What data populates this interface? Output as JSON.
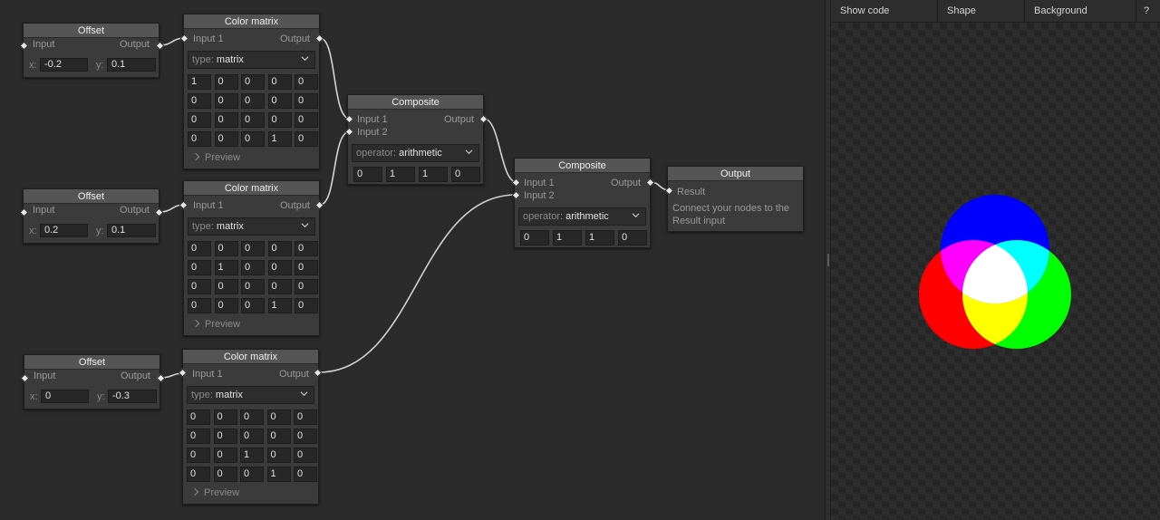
{
  "nodes": {
    "offset1": {
      "title": "Offset",
      "input": "Input",
      "output": "Output",
      "x_label": "x:",
      "x": "-0.2",
      "y_label": "y:",
      "y": "0.1"
    },
    "offset2": {
      "title": "Offset",
      "input": "Input",
      "output": "Output",
      "x_label": "x:",
      "x": "0.2",
      "y_label": "y:",
      "y": "0.1"
    },
    "offset3": {
      "title": "Offset",
      "input": "Input",
      "output": "Output",
      "x_label": "x:",
      "x": "0",
      "y_label": "y:",
      "y": "-0.3"
    },
    "matrix1": {
      "title": "Color matrix",
      "input": "Input 1",
      "output": "Output",
      "type_label": "type:",
      "type": "matrix",
      "rows": [
        [
          "1",
          "0",
          "0",
          "0",
          "0"
        ],
        [
          "0",
          "0",
          "0",
          "0",
          "0"
        ],
        [
          "0",
          "0",
          "0",
          "0",
          "0"
        ],
        [
          "0",
          "0",
          "0",
          "1",
          "0"
        ]
      ],
      "preview": "Preview"
    },
    "matrix2": {
      "title": "Color matrix",
      "input": "Input 1",
      "output": "Output",
      "type_label": "type:",
      "type": "matrix",
      "rows": [
        [
          "0",
          "0",
          "0",
          "0",
          "0"
        ],
        [
          "0",
          "1",
          "0",
          "0",
          "0"
        ],
        [
          "0",
          "0",
          "0",
          "0",
          "0"
        ],
        [
          "0",
          "0",
          "0",
          "1",
          "0"
        ]
      ],
      "preview": "Preview"
    },
    "matrix3": {
      "title": "Color matrix",
      "input": "Input 1",
      "output": "Output",
      "type_label": "type:",
      "type": "matrix",
      "rows": [
        [
          "0",
          "0",
          "0",
          "0",
          "0"
        ],
        [
          "0",
          "0",
          "0",
          "0",
          "0"
        ],
        [
          "0",
          "0",
          "1",
          "0",
          "0"
        ],
        [
          "0",
          "0",
          "0",
          "1",
          "0"
        ]
      ],
      "preview": "Preview"
    },
    "composite1": {
      "title": "Composite",
      "input1": "Input 1",
      "input2": "Input 2",
      "output": "Output",
      "operator_label": "operator:",
      "operator": "arithmetic",
      "k": [
        "0",
        "1",
        "1",
        "0"
      ]
    },
    "composite2": {
      "title": "Composite",
      "input1": "Input 1",
      "input2": "Input 2",
      "output": "Output",
      "operator_label": "operator:",
      "operator": "arithmetic",
      "k": [
        "0",
        "1",
        "1",
        "0"
      ]
    },
    "output": {
      "title": "Output",
      "input": "Result",
      "note": "Connect your nodes to the Result input"
    }
  },
  "toolbar": {
    "show_code": "Show code",
    "shape": "Shape",
    "background": "Background",
    "help": "?"
  },
  "preview_colors": {
    "red": "#ff0000",
    "green": "#00ff00",
    "blue": "#0000ff",
    "yellow": "#ffff00",
    "cyan": "#00ffff",
    "magenta": "#ff00ff",
    "white": "#ffffff"
  },
  "ui_colors": {
    "wire": "#d4d4d4",
    "node_body": "#3b3b3b",
    "node_header": "#555555",
    "editor_bg": "#2b2b2b"
  }
}
